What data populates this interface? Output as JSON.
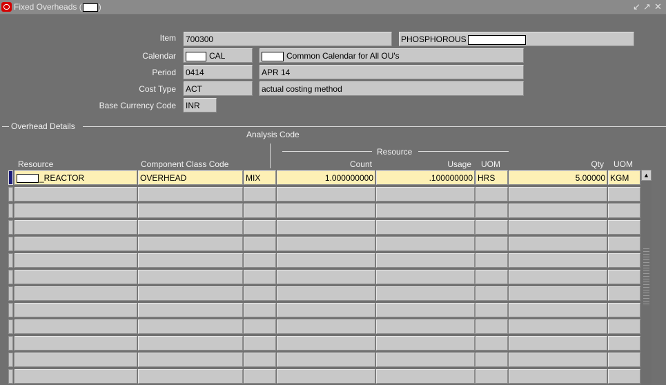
{
  "window": {
    "title_prefix": "Fixed Overheads (",
    "title_suffix": ")",
    "buttons": [
      "↙",
      "↗",
      "✕"
    ]
  },
  "header": {
    "item": {
      "label": "Item",
      "value": "700300",
      "description": "PHOSPHOROUS"
    },
    "calendar": {
      "label": "Calendar",
      "value": "CAL",
      "description": "Common Calendar for All OU's"
    },
    "period": {
      "label": "Period",
      "value": "0414",
      "description": "APR 14"
    },
    "cost_type": {
      "label": "Cost Type",
      "value": "ACT",
      "description": "actual costing method"
    },
    "base_currency": {
      "label": "Base Currency Code",
      "value": "INR"
    }
  },
  "overhead_details": {
    "section_title": "Overhead Details",
    "analysis_code_header": "Analysis Code",
    "resource_group_header": "Resource",
    "columns": {
      "resource": "Resource",
      "component_class": "Component Class Code",
      "count": "Count",
      "usage": "Usage",
      "uom": "UOM",
      "qty": "Qty",
      "qty_uom": "UOM"
    },
    "rows": [
      {
        "resource": "_REACTOR",
        "component_class": "OVERHEAD",
        "analysis_code": "MIX",
        "count": "1.000000000",
        "usage": ".100000000",
        "uom": "HRS",
        "qty": "5.00000",
        "qty_uom": "KGM"
      }
    ],
    "empty_rows": 12
  },
  "colors": {
    "background": "#707070",
    "field": "#c8c8c8",
    "active_row": "#fdf0b5",
    "current_indicator": "#1d1d7a"
  }
}
